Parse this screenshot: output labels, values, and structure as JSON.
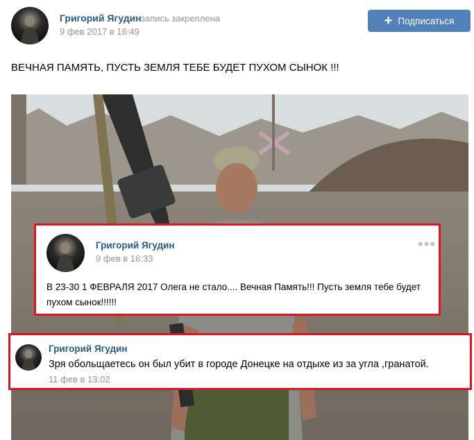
{
  "post": {
    "author": "Григорий Ягудин",
    "pinned_label": "запись закреплена",
    "date": "9 фев 2017 в 16:49",
    "text": "ВЕЧНАЯ ПАМЯТЬ, ПУСТЬ ЗЕМЛЯ ТЕБЕ БУДЕТ ПУХОМ СЫНОК !!!"
  },
  "subscribe": {
    "icon": "plus-icon",
    "label": "Подписаться"
  },
  "quoted_post": {
    "author": "Григорий Ягудин",
    "date": "9 фев в 16:33",
    "text": "В 23-30 1 ФЕВРАЛЯ 2017 Олега не стало.... Вечная Память!!! Пусть земля тебе будет пухом сынок!!!!!!",
    "menu_icon": "more-dots-icon"
  },
  "comment": {
    "author": "Григорий Ягудин",
    "text": "Зря обольщаетесь он был убит в городе Донецке на отдыхе из за угла ,гранатой.",
    "date": "11 фев в 13:02"
  },
  "colors": {
    "accent": "#5181b8",
    "link": "#2a5885",
    "meta": "#939393",
    "highlight_border": "#e0141f"
  }
}
